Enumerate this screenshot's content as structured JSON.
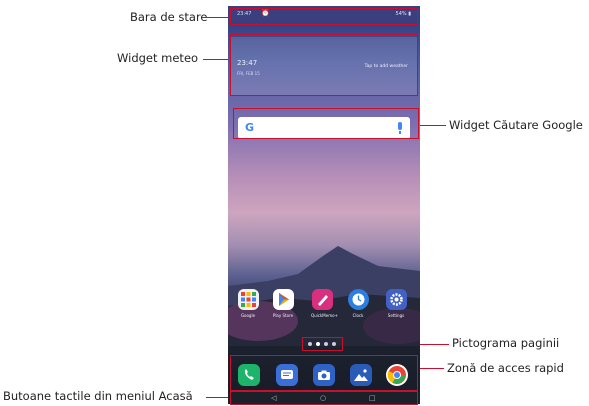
{
  "labels": {
    "status_bar": "Bara de stare",
    "weather_widget": "Widget meteo",
    "google_search_widget": "Widget Căutare Google",
    "page_icon": "Pictograma paginii",
    "quick_access": "Zonă de acces rapid",
    "home_touch_buttons": "Butoane tactile din meniul Acasă"
  },
  "status_bar": {
    "time": "23:47",
    "right_text": "54% ▮"
  },
  "weather": {
    "time": "23:47",
    "date": "FRI, FEB 15",
    "tap_text": "Tap to add weather"
  },
  "apps": [
    {
      "label": "Google",
      "icon": "google-folder-icon"
    },
    {
      "label": "Play Store",
      "icon": "play-store-icon"
    },
    {
      "label": "QuickMemo+",
      "icon": "quickmemo-icon"
    },
    {
      "label": "Clock",
      "icon": "clock-icon"
    },
    {
      "label": "Settings",
      "icon": "settings-icon"
    }
  ],
  "dock": [
    "phone-icon",
    "messages-icon",
    "camera-icon",
    "gallery-icon",
    "chrome-icon"
  ],
  "nav": {
    "back": "◁",
    "home": "○",
    "recents": "□"
  },
  "colors": {
    "annotation": "#c8102e"
  }
}
